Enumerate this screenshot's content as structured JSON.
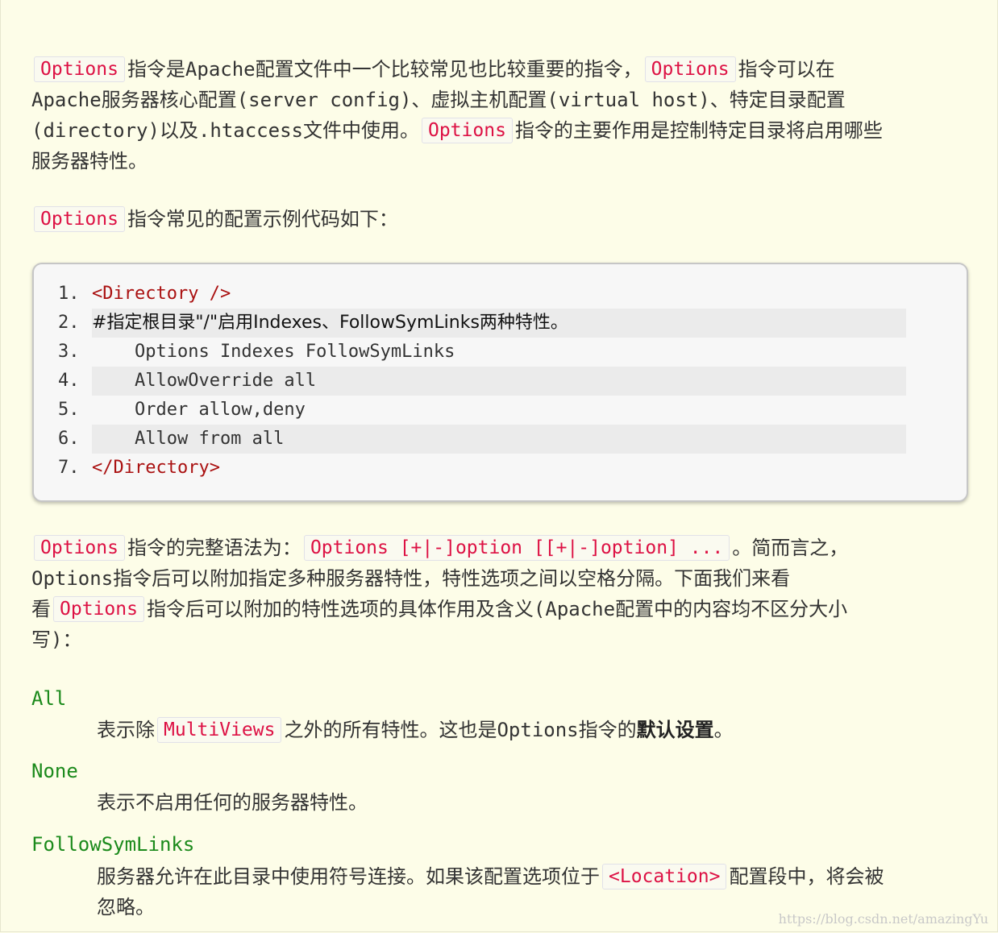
{
  "intro": {
    "code1": "Options",
    "t1": "指令是Apache配置文件中一个比较常见也比较重要的指令，",
    "code2": "Options",
    "t2": "指令可以在",
    "line2": "Apache服务器核心配置(server config)、虚拟主机配置(virtual host)、特定目录配置",
    "t3": "(directory)以及.htaccess文件中使用。",
    "code3": "Options",
    "t4": "指令的主要作用是控制特定目录将启用哪些",
    "line4": "服务器特性。"
  },
  "example_intro": {
    "code": "Options",
    "text": "指令常见的配置示例代码如下："
  },
  "code_block": {
    "lines": [
      {
        "num": "1.",
        "text": "<Directory />"
      },
      {
        "num": "2.",
        "text": "#指定根目录\"/\"启用Indexes、FollowSymLinks两种特性。"
      },
      {
        "num": "3.",
        "text": "    Options Indexes FollowSymLinks"
      },
      {
        "num": "4.",
        "text": "    AllowOverride all"
      },
      {
        "num": "5.",
        "text": "    Order allow,deny"
      },
      {
        "num": "6.",
        "text": "    Allow from all"
      },
      {
        "num": "7.",
        "text": "</Directory>"
      }
    ]
  },
  "syntax": {
    "code1": "Options",
    "t1": "指令的完整语法为：",
    "code2": "Options [+|-]option [[+|-]option] ...",
    "t2": "。简而言之，",
    "line2": "Options指令后可以附加指定多种服务器特性，特性选项之间以空格分隔。下面我们来看",
    "t3a": "看",
    "code3": "Options",
    "t3b": "指令后可以附加的特性选项的具体作用及含义(Apache配置中的内容均不区分大小",
    "line4": "写)："
  },
  "definitions": [
    {
      "term": "All",
      "pre": "表示除",
      "code": "MultiViews",
      "post": "之外的所有特性。这也是Options指令的",
      "bold": "默认设置",
      "end": "。"
    },
    {
      "term": "None",
      "text": "表示不启用任何的服务器特性。"
    },
    {
      "term": "FollowSymLinks",
      "pre": "服务器允许在此目录中使用符号连接。如果该配置选项位于",
      "code": "<Location>",
      "post": "配置段中，将会被",
      "line2": "忽略。"
    }
  ],
  "watermark": "https://blog.csdn.net/amazingYu",
  "colors": {
    "inline_code": "#dd1144",
    "term": "#1b8a1b",
    "tag": "#aa1111",
    "background": "#fdfde8"
  }
}
